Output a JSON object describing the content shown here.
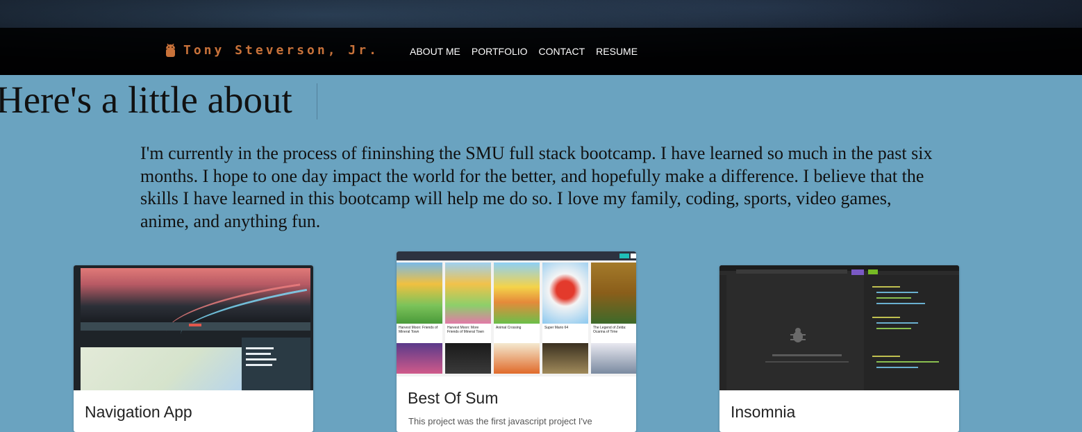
{
  "header": {
    "brand_name": "Tony Steverson, Jr.",
    "brand_icon": "android-icon",
    "nav": [
      {
        "label": "ABOUT ME"
      },
      {
        "label": "PORTFOLIO"
      },
      {
        "label": "CONTACT"
      },
      {
        "label": "RESUME"
      }
    ]
  },
  "about": {
    "heading": "Here's a little about",
    "paragraph": "I'm currently in the process of fininshing the SMU full stack bootcamp. I have learned so much in the past six months. I hope to one day impact the world for the better, and hopefully make a difference. I believe that the skills I have learned in this bootcamp will help me do so. I love my family, coding, sports, video games, anime, and anything fun."
  },
  "projects": [
    {
      "title": "Navigation App",
      "description": ""
    },
    {
      "title": "Best Of Sum",
      "description": "This project was the first javascript project I've"
    },
    {
      "title": "Insomnia",
      "description": ""
    }
  ],
  "games": [
    {
      "name": "Harvest Moon: Friends of Mineral Town"
    },
    {
      "name": "Harvest Moon: More Friends of Mineral Town"
    },
    {
      "name": "Animal Crossing"
    },
    {
      "name": "Super Mario 64"
    },
    {
      "name": "The Legend of Zelda: Ocarina of Time"
    }
  ],
  "colors": {
    "page_background": "#6aa3c0",
    "brand": "#c8723a",
    "nav_text": "#ffffff"
  }
}
